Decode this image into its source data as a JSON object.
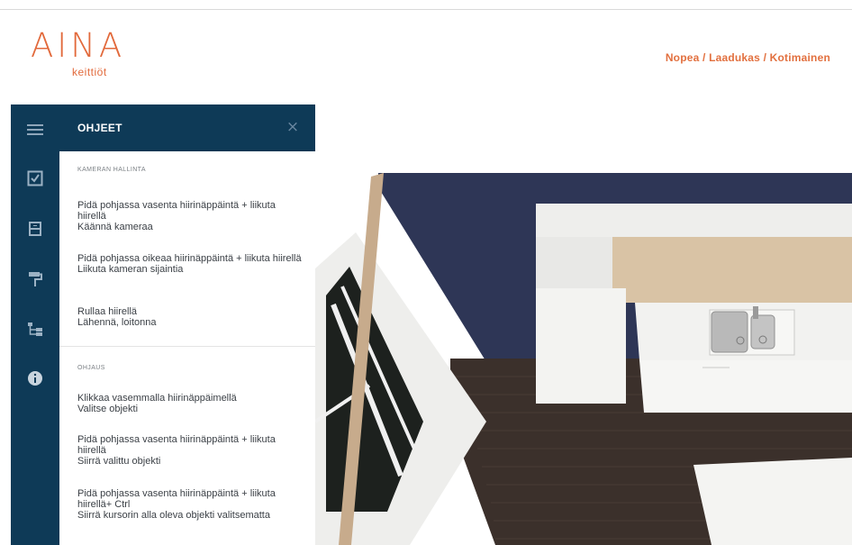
{
  "brand": {
    "logo_text": "AINA",
    "logo_sub": "keittiöt",
    "tagline": "Nopea / Laadukas / Kotimainen"
  },
  "rail": {
    "icons": [
      "menu-icon",
      "checklist-icon",
      "cabinet-icon",
      "paint-roller-icon",
      "tree-structure-icon",
      "info-icon"
    ]
  },
  "panel": {
    "title": "OHJEET",
    "close_glyph": "×",
    "sections": [
      {
        "title": "KAMERAN HALLINTA",
        "items": [
          {
            "action": "Pidä pohjassa vasenta hiirinäppäintä + liikuta hiirellä",
            "result": "Käännä kameraa"
          },
          {
            "action": "Pidä pohjassa oikeaa hiirinäppäintä + liikuta hiirellä",
            "result": "Liikuta kameran sijaintia"
          },
          {
            "action": "Rullaa hiirellä",
            "result": "Lähennä, loitonna"
          }
        ]
      },
      {
        "title": "OHJAUS",
        "items": [
          {
            "action": "Klikkaa vasemmalla hiirinäppäimellä",
            "result": "Valitse objekti"
          },
          {
            "action": "Pidä pohjassa vasenta hiirinäppäintä + liikuta hiirellä",
            "result": "Siirrä valittu objekti"
          },
          {
            "action": "Pidä pohjassa vasenta hiirinäppäintä + liikuta hiirellä+ Ctrl",
            "result": "Siirrä kursorin alla oleva objekti valitsematta"
          }
        ]
      }
    ]
  },
  "colors": {
    "brand_orange": "#e26a3c",
    "navy": "#0e3a57",
    "wall": "#2e3656",
    "floor": "#3b302b",
    "counter": "#f2f2f0",
    "wood": "#d9c3a5"
  }
}
